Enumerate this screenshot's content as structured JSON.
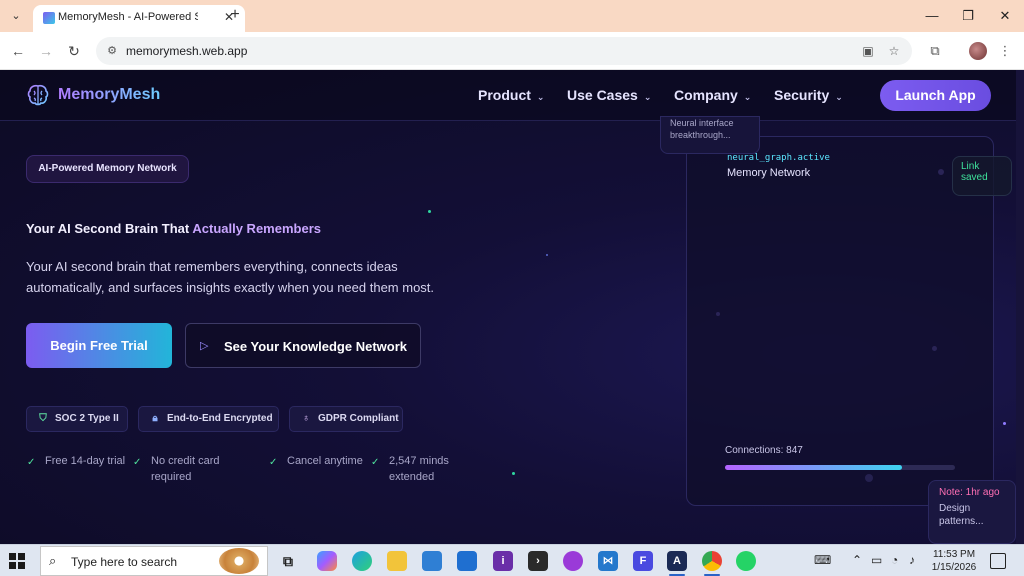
{
  "browser": {
    "tab_title": "MemoryMesh - AI-Powered Se",
    "tab_close": "✕",
    "new_tab": "+",
    "url": "memorymesh.web.app",
    "window_controls": {
      "minimize": "—",
      "maximize": "❐",
      "close": "✕"
    },
    "nav": {
      "back": "←",
      "forward": "→",
      "reload": "↻"
    }
  },
  "site": {
    "brand": "MemoryMesh",
    "nav": [
      {
        "label": "Product"
      },
      {
        "label": "Use Cases"
      },
      {
        "label": "Company"
      },
      {
        "label": "Security"
      }
    ],
    "launch_label": "Launch App",
    "chevron": "⌄"
  },
  "hero": {
    "badge": "AI-Powered Memory Network",
    "headline_part1": "Your AI Second Brain That ",
    "headline_part2": "Actually Remembers",
    "subtext": "Your AI second brain that remembers everything, connects ideas automatically, and surfaces insights exactly when you need them most.",
    "cta_primary": "Begin Free Trial",
    "cta_secondary": "See Your Knowledge Network",
    "trust_badges": [
      {
        "label": "SOC 2 Type II",
        "icon": "shield-icon"
      },
      {
        "label": "End-to-End Encrypted",
        "icon": "lock-icon"
      },
      {
        "label": "GDPR Compliant",
        "icon": "award-icon"
      }
    ],
    "features": [
      {
        "label": "Free 14-day trial"
      },
      {
        "label": "No credit card required"
      },
      {
        "label": "Cancel anytime"
      },
      {
        "label": "2,547 minds extended"
      }
    ]
  },
  "visual": {
    "float_card": "Neural interface breakthrough...",
    "code_label": "neural_graph.active",
    "title": "Memory Network",
    "connections_label": "Connections: 847",
    "connections_progress": 0.77,
    "link_saved": "Link saved",
    "note_time": "Note: 1hr ago",
    "note_text": "Design patterns..."
  },
  "taskbar": {
    "search_placeholder": "Type here to search",
    "time": "11:53 PM",
    "date": "1/15/2026"
  },
  "colors": {
    "accent": "#7c5cf0",
    "accent_cyan": "#22b5d9",
    "success": "#4fe29d",
    "page_bg": "#0d0b22"
  }
}
